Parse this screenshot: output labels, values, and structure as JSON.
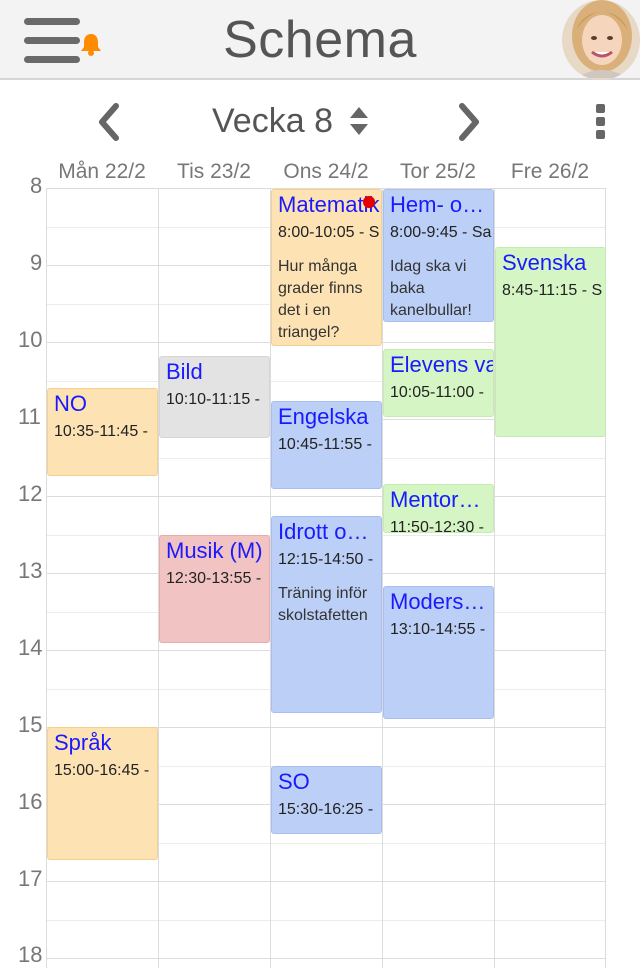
{
  "header": {
    "title": "Schema"
  },
  "week_nav": {
    "label": "Vecka 8"
  },
  "days": [
    "Mån 22/2",
    "Tis 23/2",
    "Ons 24/2",
    "Tor 25/2",
    "Fre 26/2"
  ],
  "hours": [
    "8",
    "9",
    "10",
    "11",
    "12",
    "13",
    "14",
    "15",
    "16",
    "17",
    "18"
  ],
  "events": {
    "mon_no": {
      "title": "NO",
      "time": "10:35-11:45 -"
    },
    "mon_sprak": {
      "title": "Språk",
      "time": "15:00-16:45 -"
    },
    "tue_bild": {
      "title": "Bild",
      "time": "10:10-11:15 -"
    },
    "tue_musik": {
      "title": "Musik (M)",
      "time": "12:30-13:55 -"
    },
    "wed_mat": {
      "title": "Matematik",
      "time": "8:00-10:05 - S",
      "note": "Hur många grader finns det i en triangel?"
    },
    "wed_eng": {
      "title": "Engelska",
      "time": "10:45-11:55 -"
    },
    "wed_idrott": {
      "title": "Idrott oc…",
      "time": "12:15-14:50 -",
      "note": "Träning inför skolstafetten"
    },
    "wed_so": {
      "title": "SO",
      "time": "15:30-16:25 -"
    },
    "thu_hem": {
      "title": "Hem- oc…",
      "time": "8:00-9:45 - Sa",
      "note": "Idag ska vi baka kanelbullar!"
    },
    "thu_elevens": {
      "title": "Elevens va",
      "time": "10:05-11:00 -"
    },
    "thu_mentors": {
      "title": "Mentors…",
      "time": "11:50-12:30 -"
    },
    "thu_moders": {
      "title": "Moders…",
      "time": "13:10-14:55 -"
    },
    "fri_svenska": {
      "title": "Svenska",
      "time": "8:45-11:15 - S"
    }
  },
  "colors": {
    "accent_blue_text": "#1a1aff",
    "notification": "#ff8c00",
    "unread_dot": "#e50000"
  }
}
